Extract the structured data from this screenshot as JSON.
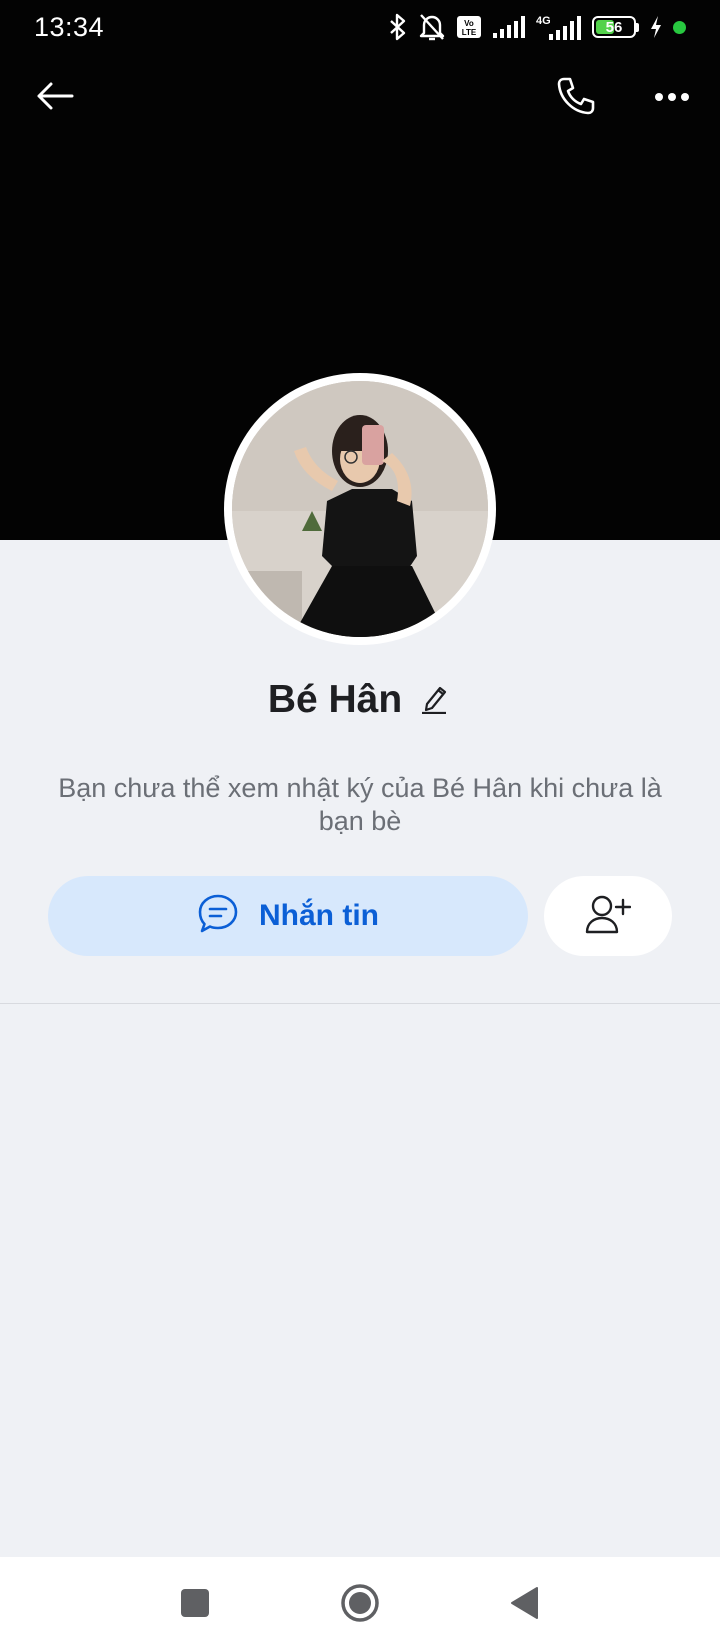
{
  "status_bar": {
    "time": "13:34",
    "network_label": "4G",
    "volte_label": "Vo LTE",
    "battery_percent": "56",
    "battery_level": 0.56,
    "icons": [
      "bluetooth-icon",
      "bell-off-icon",
      "volte-icon",
      "signal-icon",
      "signal-4g-icon",
      "battery-icon",
      "charging-icon",
      "active-dot-icon"
    ],
    "battery_color": "#53d24b",
    "dot_color": "#28c840"
  },
  "header": {
    "icons": [
      "back-arrow-icon",
      "phone-icon",
      "more-icon"
    ],
    "cover_color": "#030303"
  },
  "profile": {
    "name": "Bé Hân",
    "notice": "Bạn chưa thể xem nhật ký của Bé Hân khi chưa là bạn bè"
  },
  "actions": {
    "message_label": "Nhắn tin",
    "message_icon": "chat-bubble-icon",
    "add_friend_icon": "add-user-icon",
    "accent_color": "#0b5fd6",
    "message_bg": "#d7e8fc"
  },
  "nav_bar": {
    "icons": [
      "square-recents-icon",
      "circle-home-icon",
      "triangle-back-icon"
    ]
  }
}
